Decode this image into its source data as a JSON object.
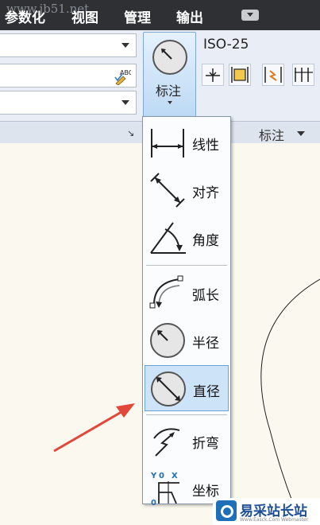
{
  "menubar": {
    "items": [
      "参数化",
      "视图",
      "管理",
      "输出"
    ],
    "watermark": "www.jb51.net"
  },
  "ribbon": {
    "dim_button_label": "标注",
    "dim_style": "ISO-25",
    "panel_title": "标注"
  },
  "dropdown": {
    "items": [
      {
        "label": "线性",
        "icon": "linear-dimension-icon",
        "selected": false
      },
      {
        "label": "对齐",
        "icon": "aligned-dimension-icon",
        "selected": false
      },
      {
        "label": "角度",
        "icon": "angular-dimension-icon",
        "selected": false
      },
      {
        "label": "弧长",
        "icon": "arc-length-icon",
        "selected": false
      },
      {
        "label": "半径",
        "icon": "radius-icon",
        "selected": false
      },
      {
        "label": "直径",
        "icon": "diameter-icon",
        "selected": true
      },
      {
        "label": "折弯",
        "icon": "jogged-icon",
        "selected": false
      },
      {
        "label": "坐标",
        "icon": "ordinate-icon",
        "selected": false
      }
    ]
  },
  "watermark2": {
    "name": "易采站长站",
    "sub": "Www.Easck.Com Webmaster"
  },
  "colors": {
    "menubar_bg": "#2e3033",
    "selection": "#cde4f8",
    "arrow": "#e3473a"
  }
}
